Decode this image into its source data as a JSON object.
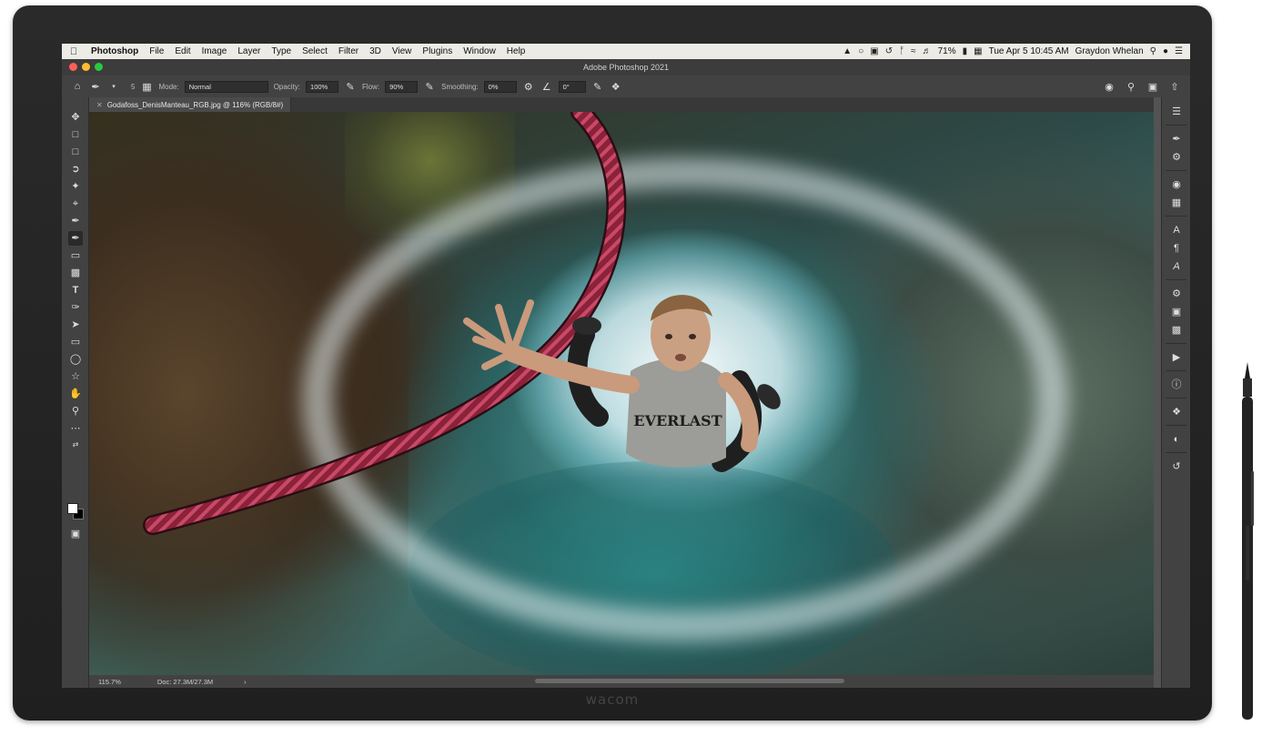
{
  "device": {
    "brand": "wacom"
  },
  "menubar": {
    "app": "Photoshop",
    "items": [
      "File",
      "Edit",
      "Image",
      "Layer",
      "Type",
      "Select",
      "Filter",
      "3D",
      "View",
      "Plugins",
      "Window",
      "Help"
    ],
    "battery": "71%",
    "datetime": "Tue Apr 5  10:45 AM",
    "user": "Graydon Whelan"
  },
  "window": {
    "title": "Adobe Photoshop 2021"
  },
  "options": {
    "brush_size": "5",
    "mode_label": "Mode:",
    "mode_value": "Normal",
    "opacity_label": "Opacity:",
    "opacity_value": "100%",
    "flow_label": "Flow:",
    "flow_value": "90%",
    "smoothing_label": "Smoothing:",
    "smoothing_value": "0%",
    "angle_value": "0°"
  },
  "document": {
    "tab_title": "Godafoss_DenisManteau_RGB.jpg @ 116% (RGB/8#)"
  },
  "canvas": {
    "shirt_text": "EVERLAST"
  },
  "status": {
    "zoom": "115.7%",
    "doc": "Doc: 27.3M/27.3M",
    "arrow": "›"
  },
  "colors": {
    "foreground": "#ffffff",
    "background": "#000000"
  }
}
